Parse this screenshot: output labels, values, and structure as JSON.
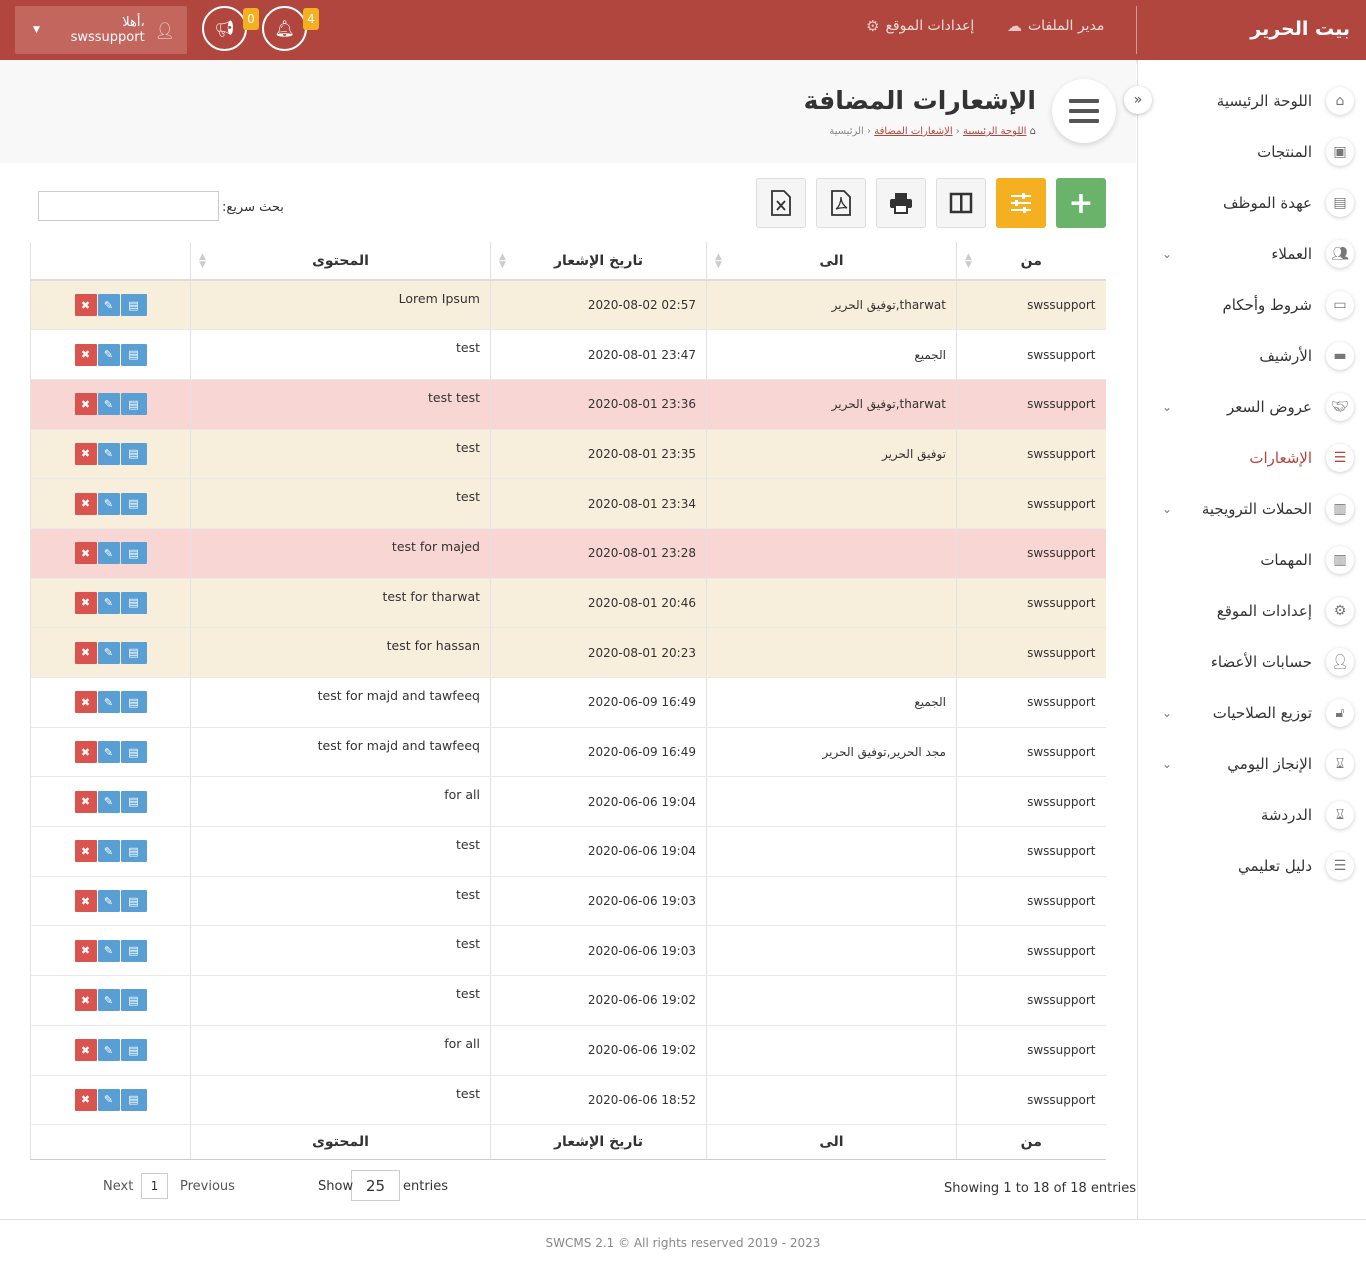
{
  "header": {
    "brand": "بيت الحرير",
    "links": [
      {
        "label": "مدير الملفات",
        "icon": "cloud-upload-icon"
      },
      {
        "label": "إعدادات الموقع",
        "icon": "gear-icon"
      }
    ],
    "notifications_count": "4",
    "announcements_count": "0",
    "user_greeting": "أهلا،",
    "user_name": "swssupport"
  },
  "sidebar": {
    "items": [
      {
        "label": "اللوحة الرئيسية",
        "icon": "home-icon"
      },
      {
        "label": "المنتجات",
        "icon": "medkit-icon"
      },
      {
        "label": "عهدة الموظف",
        "icon": "id-card-icon"
      },
      {
        "label": "العملاء",
        "icon": "users-icon",
        "expandable": true
      },
      {
        "label": "شروط وأحكام",
        "icon": "credit-card-icon"
      },
      {
        "label": "الأرشيف",
        "icon": "archive-icon"
      },
      {
        "label": "عروض السعر",
        "icon": "handshake-icon",
        "expandable": true
      },
      {
        "label": "الإشعارات",
        "icon": "list-icon",
        "active": true
      },
      {
        "label": "الحملات الترويجية",
        "icon": "barcode-icon",
        "expandable": true
      },
      {
        "label": "المهمات",
        "icon": "barcode-icon"
      },
      {
        "label": "إعدادات الموقع",
        "icon": "gear-icon"
      },
      {
        "label": "حسابات الأعضاء",
        "icon": "user-icon"
      },
      {
        "label": "توزيع الصلاحيات",
        "icon": "lock-icon",
        "expandable": true
      },
      {
        "label": "الإنجاز اليومي",
        "icon": "hourglass-icon",
        "expandable": true
      },
      {
        "label": "الدردشة",
        "icon": "hourglass-icon"
      },
      {
        "label": "دليل تعليمي",
        "icon": "list-icon"
      }
    ]
  },
  "page": {
    "title": "الإشعارات المضافة",
    "breadcrumb": [
      "اللوحة الرئيسية",
      "الإشعارات المضافة",
      "الرئيسية"
    ]
  },
  "toolbar": {
    "search_label": "بحث سريع:",
    "search_value": ""
  },
  "table": {
    "columns": [
      "من",
      "الى",
      "تاريخ الإشعار",
      "المحتوى"
    ],
    "rows": [
      {
        "from": "swssupport",
        "to": "توفيق الحرير,tharwat",
        "date": "2020-08-02 02:57",
        "content": "Lorem Ipsum",
        "style": "amber"
      },
      {
        "from": "swssupport",
        "to": "الجميع",
        "date": "2020-08-01 23:47",
        "content": "test",
        "style": "white"
      },
      {
        "from": "swssupport",
        "to": "توفيق الحرير,tharwat",
        "date": "2020-08-01 23:36",
        "content": "test test",
        "style": "red"
      },
      {
        "from": "swssupport",
        "to": "توفيق الحرير",
        "date": "2020-08-01 23:35",
        "content": "test",
        "style": "amber"
      },
      {
        "from": "swssupport",
        "to": "",
        "date": "2020-08-01 23:34",
        "content": "test",
        "style": "amber"
      },
      {
        "from": "swssupport",
        "to": "",
        "date": "2020-08-01 23:28",
        "content": "test for majed",
        "style": "red"
      },
      {
        "from": "swssupport",
        "to": "",
        "date": "2020-08-01 20:46",
        "content": "test for tharwat",
        "style": "amber"
      },
      {
        "from": "swssupport",
        "to": "",
        "date": "2020-08-01 20:23",
        "content": "test for hassan",
        "style": "amber"
      },
      {
        "from": "swssupport",
        "to": "الجميع",
        "date": "2020-06-09 16:49",
        "content": "test for majd and tawfeeq",
        "style": "white"
      },
      {
        "from": "swssupport",
        "to": "مجد الحرير,توفيق الحرير",
        "date": "2020-06-09 16:49",
        "content": "test for majd and tawfeeq",
        "style": "white"
      },
      {
        "from": "swssupport",
        "to": "",
        "date": "2020-06-06 19:04",
        "content": "for all",
        "style": "white"
      },
      {
        "from": "swssupport",
        "to": "",
        "date": "2020-06-06 19:04",
        "content": "test",
        "style": "white"
      },
      {
        "from": "swssupport",
        "to": "",
        "date": "2020-06-06 19:03",
        "content": "test",
        "style": "white"
      },
      {
        "from": "swssupport",
        "to": "",
        "date": "2020-06-06 19:03",
        "content": "test",
        "style": "white"
      },
      {
        "from": "swssupport",
        "to": "",
        "date": "2020-06-06 19:02",
        "content": "test",
        "style": "white"
      },
      {
        "from": "swssupport",
        "to": "",
        "date": "2020-06-06 19:02",
        "content": "for all",
        "style": "white"
      },
      {
        "from": "swssupport",
        "to": "",
        "date": "2020-06-06 18:52",
        "content": "test",
        "style": "white"
      }
    ]
  },
  "footer_table": {
    "info": "Showing 1 to 18 of 18 entries",
    "show_label": "Show",
    "entries_label": "entries",
    "page_size": "25",
    "next_label": "Next",
    "previous_label": "Previous",
    "current_page": "1"
  },
  "copyright": "SWCMS 2.1 © All rights reserved 2019 - 2023",
  "colors": {
    "primary": "#b0463d",
    "add_button": "#6ab36b",
    "filter_button": "#f4b020",
    "row_amber": "#f7eedc",
    "row_red": "#f8d6d3",
    "delete": "#d9534f",
    "edit": "#5a9fd4"
  }
}
